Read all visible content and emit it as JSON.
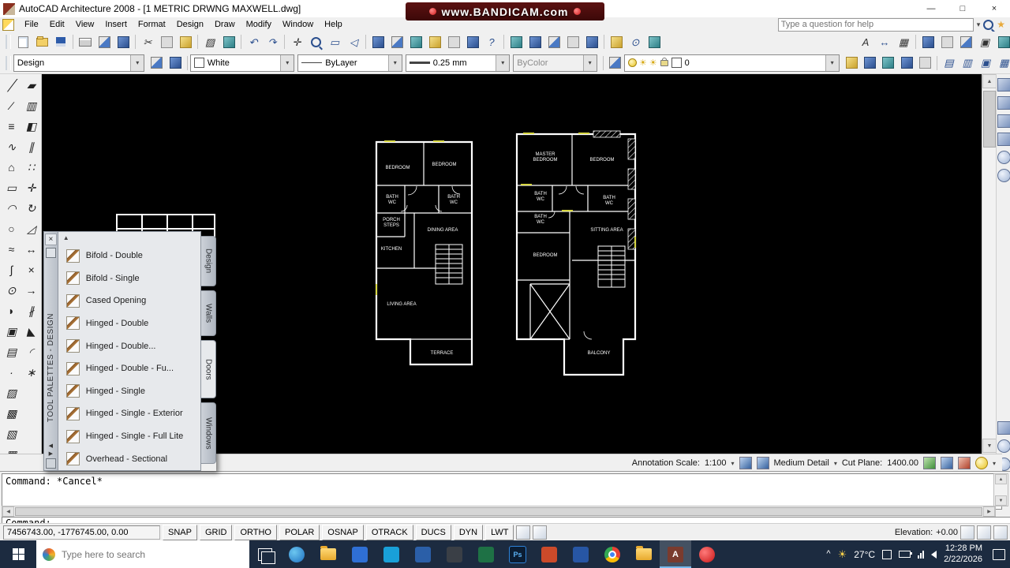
{
  "icon_glyphs": {
    "close": "×",
    "minimize": "—",
    "maximize": "□",
    "dropdown": "▾",
    "up": "▲",
    "down": "▼",
    "left": "◀",
    "right": "▶",
    "star": "★",
    "chevron_up": "^"
  },
  "window": {
    "title": "AutoCAD Architecture 2008 - [1 METRIC DRWNG MAXWELL.dwg]"
  },
  "watermark": {
    "text": "www.BANDICAM.com"
  },
  "menubar": {
    "items": [
      "File",
      "Edit",
      "View",
      "Insert",
      "Format",
      "Design",
      "Draw",
      "Modify",
      "Window",
      "Help"
    ],
    "help_box": {
      "placeholder": "Type a question for help"
    }
  },
  "styles_bar": {
    "style_value": "Design",
    "color_value": "White",
    "linetype_value": "ByLayer",
    "lineweight_value": "0.25 mm",
    "plotstyle_value": "ByColor",
    "layer_value": "0"
  },
  "palette": {
    "title": "TOOL PALETTES - DESIGN",
    "tabs": [
      "Design",
      "Walls",
      "Doors",
      "Windows"
    ],
    "items": [
      "Bifold - Double",
      "Bifold - Single",
      "Cased Opening",
      "Hinged - Double",
      "Hinged - Double...",
      "Hinged - Double - Fu...",
      "Hinged - Single",
      "Hinged - Single - Exterior",
      "Hinged - Single - Full Lite",
      "Overhead - Sectional"
    ]
  },
  "drawing": {
    "labels": [
      "BEDROOM",
      "BEDROOM",
      "BATH",
      "WC",
      "BATH",
      "WC",
      "PORCH",
      "STEPS",
      "DINING AREA",
      "KITCHEN",
      "LIVING AREA",
      "TERRACE",
      "MASTER",
      "BEDROOM",
      "BEDROOM",
      "BATH",
      "WC",
      "BATH",
      "WC",
      "BATH",
      "WC",
      "SITTING AREA",
      "BEDROOM",
      "BALCONY"
    ]
  },
  "drawing_status": {
    "annotation_scale_label": "Annotation Scale:",
    "annotation_scale_value": "1:100",
    "detail_value": "Medium Detail",
    "cut_plane_label": "Cut Plane:",
    "cut_plane_value": "1400.00"
  },
  "command_window": {
    "history_line": "Command: *Cancel*",
    "prompt_line": "Command:"
  },
  "status_bar": {
    "coordinates": "7456743.00, -1776745.00, 0.00",
    "modes": [
      "SNAP",
      "GRID",
      "ORTHO",
      "POLAR",
      "OSNAP",
      "OTRACK",
      "DUCS",
      "DYN",
      "LWT"
    ],
    "elevation_label": "Elevation:",
    "elevation_value": "+0.00"
  },
  "taskbar": {
    "search_placeholder": "Type here to search",
    "weather_temp": "27°C",
    "time": "12:28 PM",
    "date": "2/22/2026"
  }
}
